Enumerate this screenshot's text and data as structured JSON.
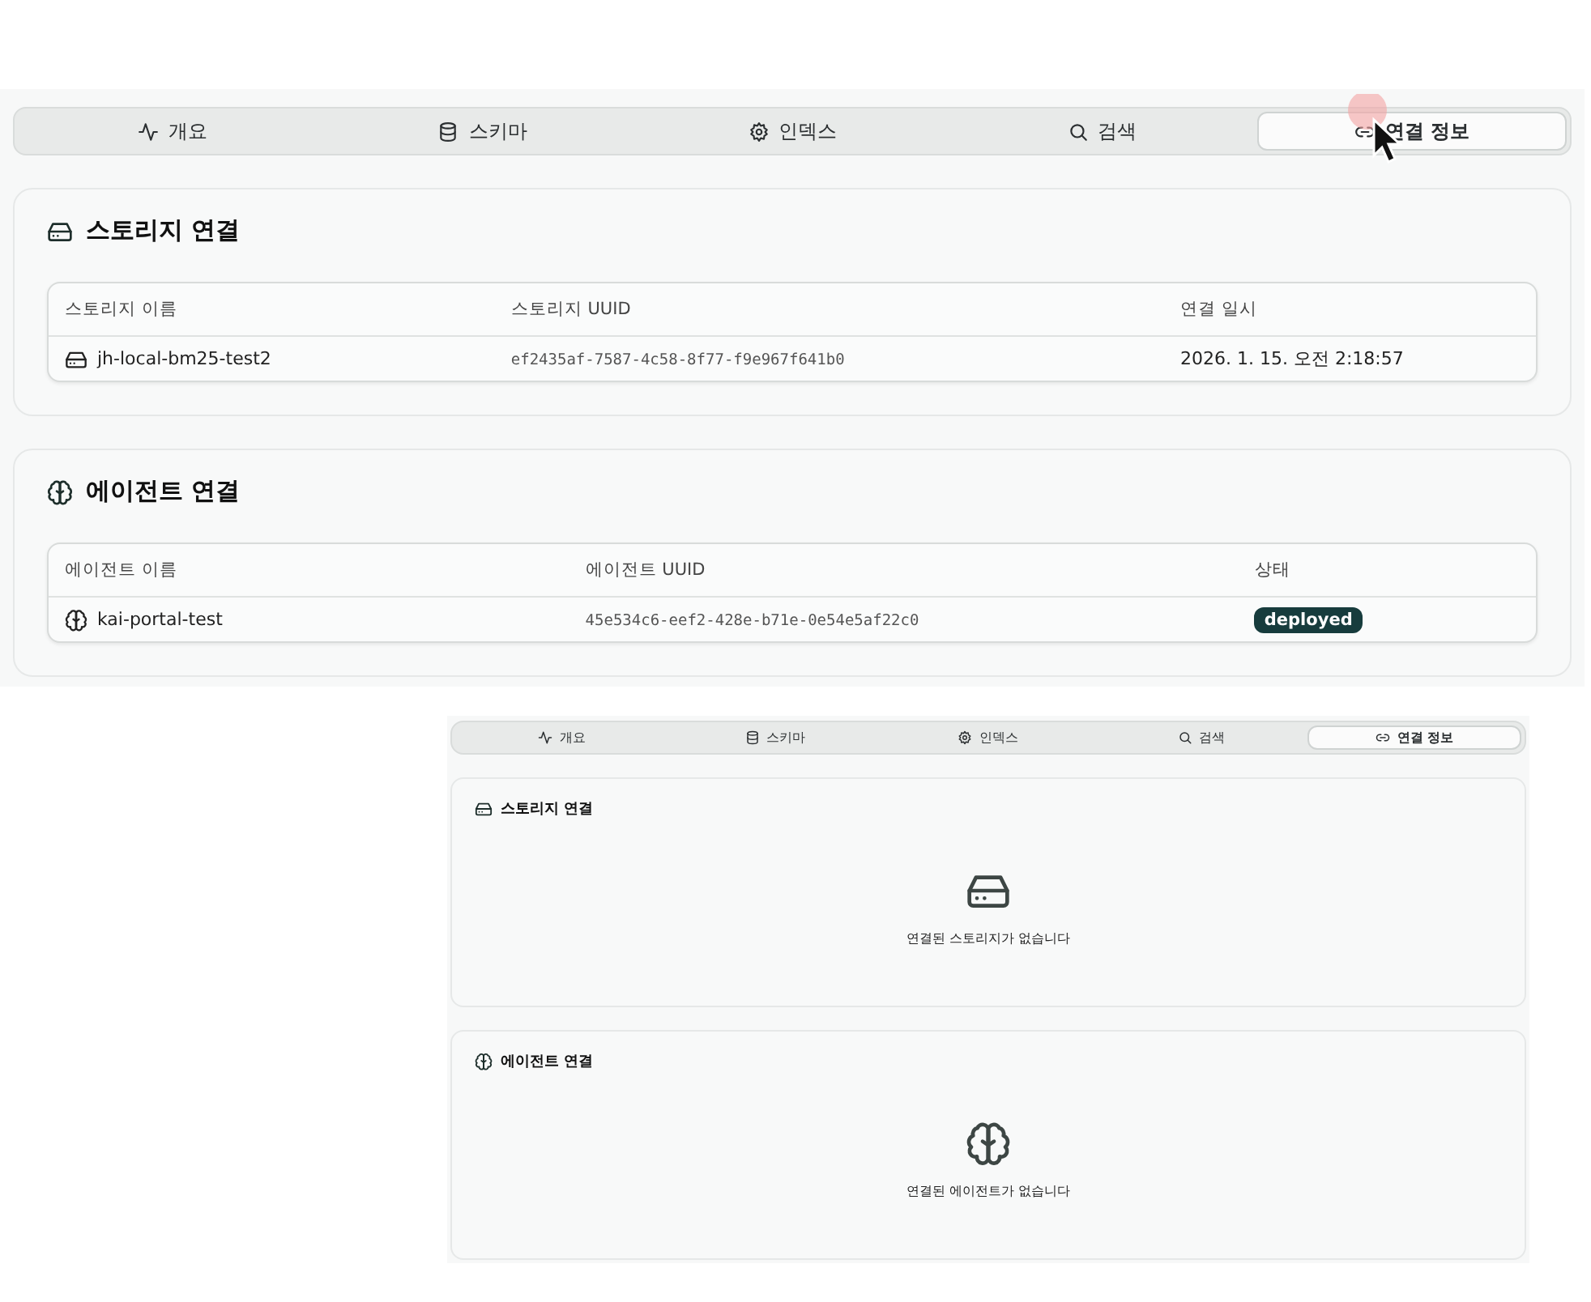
{
  "views": [
    {
      "tabs": [
        {
          "label": "개요",
          "selected": false
        },
        {
          "label": "스키마",
          "selected": false
        },
        {
          "label": "인덱스",
          "selected": false
        },
        {
          "label": "검색",
          "selected": false
        },
        {
          "label": "연결 정보",
          "selected": true
        }
      ],
      "sections": [
        {
          "kind": "table",
          "title": "스토리지 연결",
          "columns": [
            "스토리지 이름",
            "스토리지 UUID",
            "연결 일시"
          ],
          "rows": [
            {
              "cells": [
                {
                  "kind": "name",
                  "text": "jh-local-bm25-test2"
                },
                {
                  "kind": "uuid",
                  "text": "ef2435af-7587-4c58-8f77-f9e967f641b0"
                },
                {
                  "kind": "text",
                  "text": "2026. 1. 15. 오전 2:18:57"
                }
              ]
            }
          ]
        },
        {
          "kind": "table",
          "title": "에이전트 연결",
          "columns": [
            "에이전트 이름",
            "에이전트 UUID",
            "상태"
          ],
          "rows": [
            {
              "cells": [
                {
                  "kind": "name",
                  "text": "kai-portal-test"
                },
                {
                  "kind": "uuid",
                  "text": "45e534c6-eef2-428e-b71e-0e54e5af22c0"
                },
                {
                  "kind": "badge",
                  "text": "deployed"
                }
              ]
            }
          ]
        }
      ]
    },
    {
      "tabs": [
        {
          "label": "개요",
          "selected": false
        },
        {
          "label": "스키마",
          "selected": false
        },
        {
          "label": "인덱스",
          "selected": false
        },
        {
          "label": "검색",
          "selected": false
        },
        {
          "label": "연결 정보",
          "selected": true
        }
      ],
      "sections": [
        {
          "kind": "empty",
          "title": "스토리지 연결",
          "message": "연결된 스토리지가 없습니다"
        },
        {
          "kind": "empty",
          "title": "에이전트 연결",
          "message": "연결된 에이전트가 없습니다"
        }
      ]
    }
  ]
}
